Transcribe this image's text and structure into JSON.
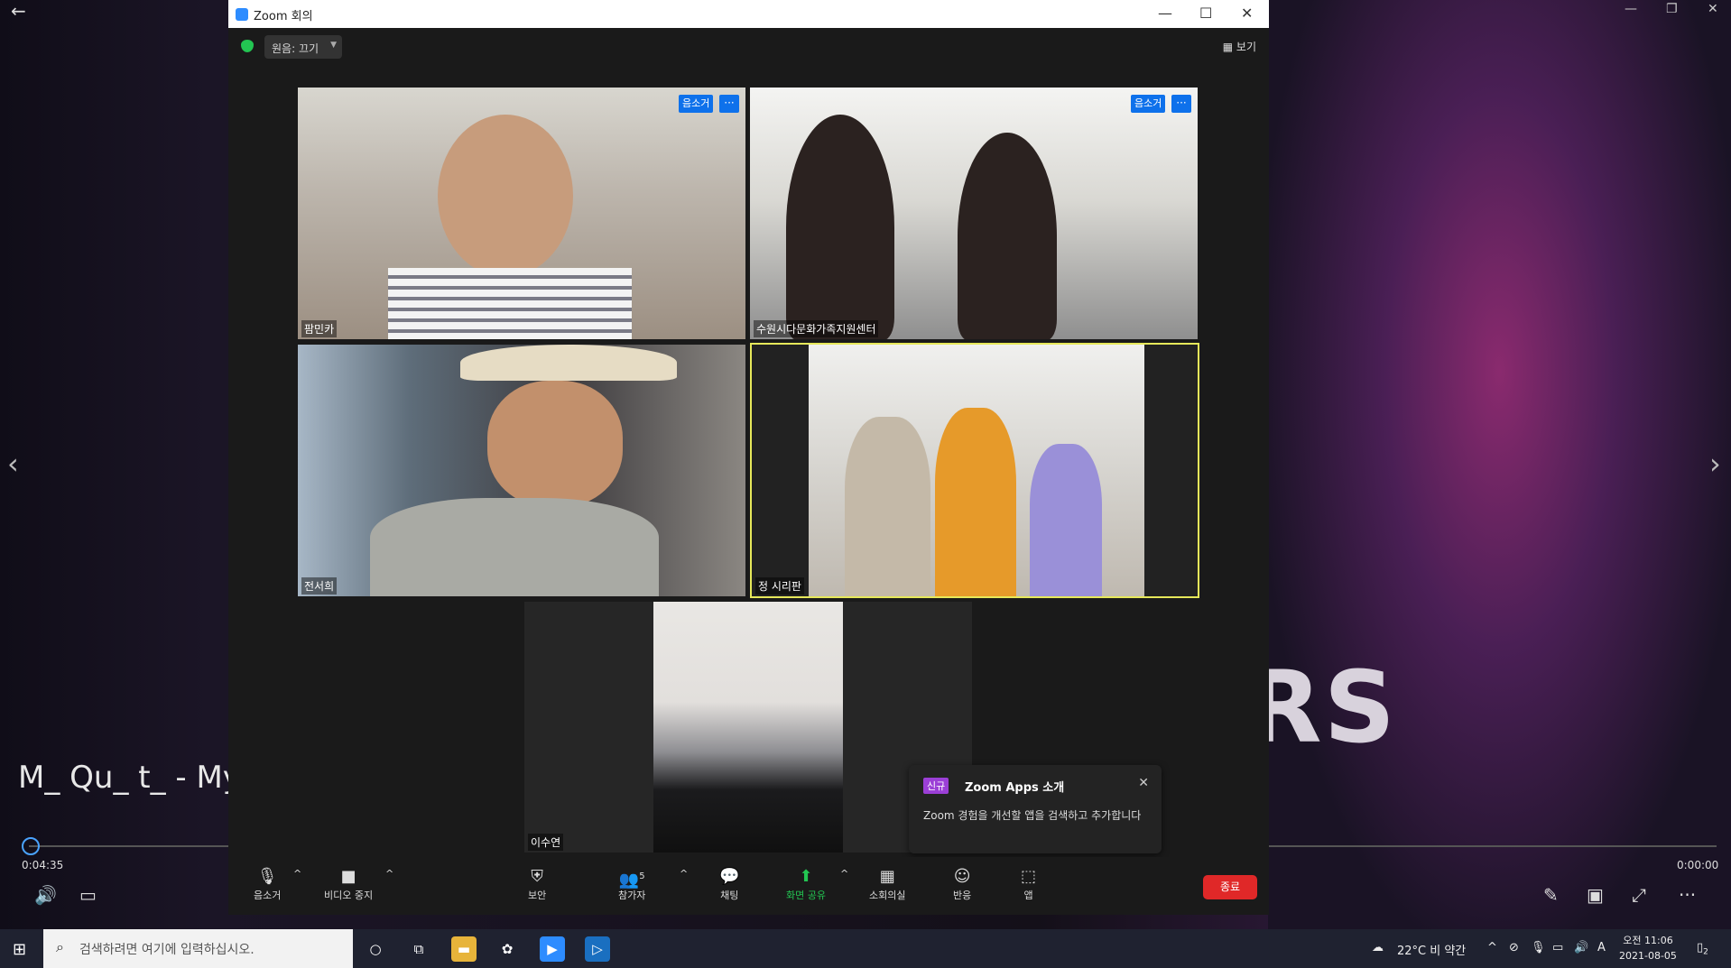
{
  "player": {
    "title": "M_ Qu_ t_ - My",
    "time_current": "0:04:35",
    "time_total": "0:00:00",
    "back_icon": "arrow-left-icon"
  },
  "zoom": {
    "window_title": "Zoom 회의",
    "recording_label": "원음: 끄기",
    "view_label": "보기",
    "tiles": [
      {
        "name": "팜민카",
        "mute_label": "음소거",
        "more_label": "···"
      },
      {
        "name": "수원시다문화가족지원센터",
        "mute_label": "음소거",
        "more_label": "···"
      },
      {
        "name": "전서희"
      },
      {
        "name": "정 시리판"
      },
      {
        "name": "이수연"
      }
    ],
    "popup": {
      "badge": "신규",
      "title": "Zoom Apps 소개",
      "body": "Zoom 경험을 개선할 앱을 검색하고 추가합니다"
    },
    "toolbar": {
      "mute": "음소거",
      "video": "비디오 중지",
      "security": "보안",
      "participants": "참가자",
      "participants_count": "5",
      "chat": "채팅",
      "share": "화면 공유",
      "breakout": "소회의실",
      "reactions": "반응",
      "apps": "앱",
      "end": "종료"
    }
  },
  "taskbar": {
    "search_placeholder": "검색하려면 여기에 입력하십시오.",
    "weather": "22°C  비 약간",
    "ime": "A",
    "clock_time": "오전 11:06",
    "clock_date": "2021-08-05",
    "notification_count": "2"
  },
  "colors": {
    "zoom_blue": "#0e71eb",
    "end_red": "#e02828",
    "active_speaker": "#e6e85a",
    "share_green": "#23c552"
  }
}
